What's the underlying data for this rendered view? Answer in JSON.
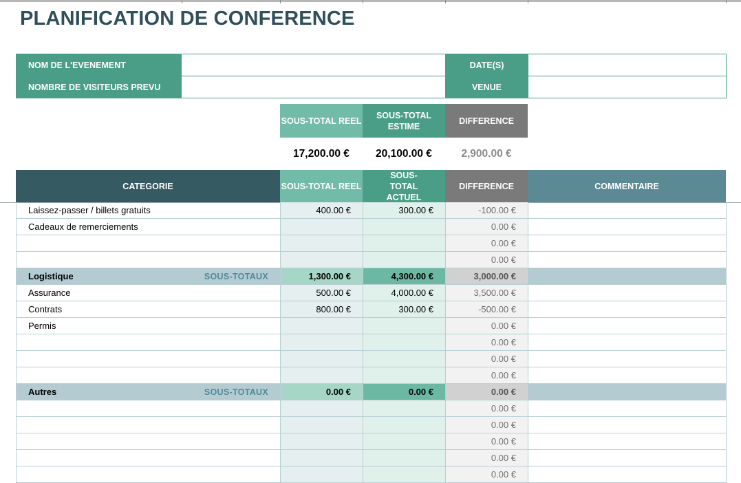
{
  "title": "PLANIFICATION DE CONFERENCE",
  "info": {
    "event_name_label": "NOM DE L'EVENEMENT",
    "event_name_value": "",
    "dates_label": "DATE(S)",
    "dates_value": "",
    "visitors_label": "NOMBRE  DE VISITEURS PREVU",
    "visitors_value": "",
    "venue_label": "VENUE",
    "venue_value": ""
  },
  "summary": {
    "actual_label": "SOUS-TOTAL REEL",
    "estimated_label": "SOUS-TOTAL ESTIME",
    "difference_label": "DIFFERENCE",
    "actual_value": "17,200.00 €",
    "estimated_value": "20,100.00 €",
    "difference_value": "2,900.00 €"
  },
  "table": {
    "headers": {
      "category": "CATEGORIE",
      "actual": "SOUS-TOTAL REEL",
      "current": "SOUS-TOTAL ACTUEL",
      "difference": "DIFFERENCE",
      "comment": "COMMENTAIRE"
    },
    "rows": [
      {
        "type": "item",
        "label": "Laissez-passer / billets gratuits",
        "actual": "400.00 €",
        "current": "300.00 €",
        "diff": "-100.00 €",
        "comment": ""
      },
      {
        "type": "item",
        "label": "Cadeaux de remerciements",
        "actual": "",
        "current": "",
        "diff": "0.00 €",
        "comment": ""
      },
      {
        "type": "item",
        "label": "",
        "actual": "",
        "current": "",
        "diff": "0.00 €",
        "comment": ""
      },
      {
        "type": "item",
        "label": "",
        "actual": "",
        "current": "",
        "diff": "0.00 €",
        "comment": ""
      },
      {
        "type": "subtotal",
        "label": "Logistique",
        "tag": "SOUS-TOTAUX",
        "actual": "1,300.00 €",
        "current": "4,300.00 €",
        "diff": "3,000.00 €",
        "comment": ""
      },
      {
        "type": "item",
        "label": "Assurance",
        "actual": "500.00 €",
        "current": "4,000.00 €",
        "diff": "3,500.00 €",
        "comment": ""
      },
      {
        "type": "item",
        "label": "Contrats",
        "actual": "800.00 €",
        "current": "300.00 €",
        "diff": "-500.00 €",
        "comment": ""
      },
      {
        "type": "item",
        "label": "Permis",
        "actual": "",
        "current": "",
        "diff": "0.00 €",
        "comment": ""
      },
      {
        "type": "item",
        "label": "",
        "actual": "",
        "current": "",
        "diff": "0.00 €",
        "comment": ""
      },
      {
        "type": "item",
        "label": "",
        "actual": "",
        "current": "",
        "diff": "0.00 €",
        "comment": ""
      },
      {
        "type": "item",
        "label": "",
        "actual": "",
        "current": "",
        "diff": "0.00 €",
        "comment": ""
      },
      {
        "type": "subtotal",
        "label": "Autres",
        "tag": "SOUS-TOTAUX",
        "actual": "0.00 €",
        "current": "0.00 €",
        "diff": "0.00 €",
        "comment": ""
      },
      {
        "type": "item",
        "label": "",
        "actual": "",
        "current": "",
        "diff": "0.00 €",
        "comment": ""
      },
      {
        "type": "item",
        "label": "",
        "actual": "",
        "current": "",
        "diff": "0.00 €",
        "comment": ""
      },
      {
        "type": "item",
        "label": "",
        "actual": "",
        "current": "",
        "diff": "0.00 €",
        "comment": ""
      },
      {
        "type": "item",
        "label": "",
        "actual": "",
        "current": "",
        "diff": "0.00 €",
        "comment": ""
      },
      {
        "type": "item",
        "label": "",
        "actual": "",
        "current": "",
        "diff": "0.00 €",
        "comment": ""
      }
    ]
  },
  "colors": {
    "title": "#2f4f5b",
    "teal_label": "#4a9d86",
    "dark_header": "#355a62",
    "actual_header": "#72bba8",
    "current_header": "#4a9d86",
    "difference_header": "#7a7a7a",
    "comment_header": "#5b8a95",
    "subtotal_row": "#b4cbd2"
  }
}
